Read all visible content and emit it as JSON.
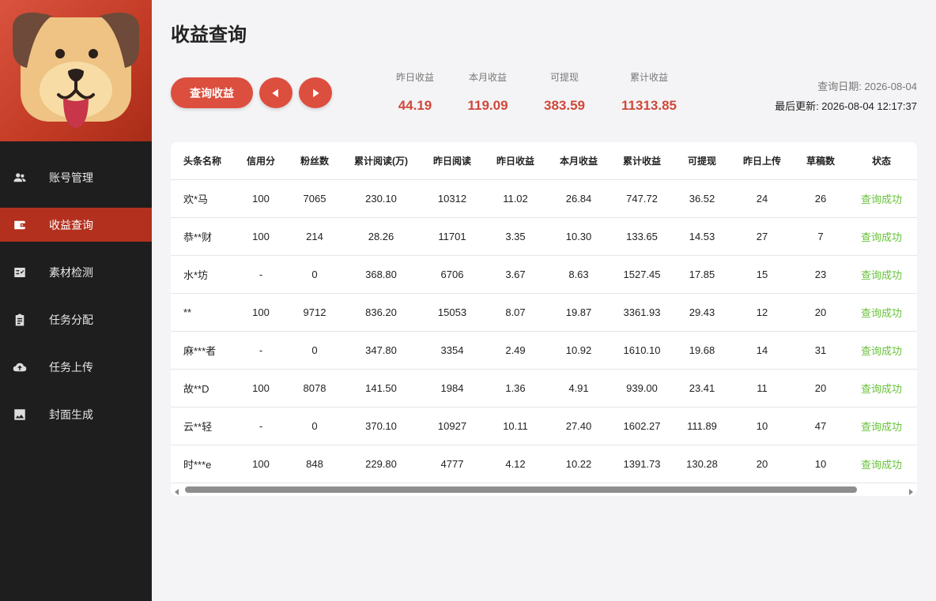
{
  "sidebar": {
    "items": [
      {
        "label": "账号管理",
        "icon": "people-icon"
      },
      {
        "label": "收益查询",
        "icon": "wallet-icon"
      },
      {
        "label": "素材检测",
        "icon": "checklist-icon"
      },
      {
        "label": "任务分配",
        "icon": "clipboard-icon"
      },
      {
        "label": "任务上传",
        "icon": "cloud-upload-icon"
      },
      {
        "label": "封面生成",
        "icon": "image-icon"
      }
    ]
  },
  "page": {
    "title": "收益查询"
  },
  "toolbar": {
    "query_label": "查询收益"
  },
  "stats": [
    {
      "label": "昨日收益",
      "value": "44.19"
    },
    {
      "label": "本月收益",
      "value": "119.09"
    },
    {
      "label": "可提现",
      "value": "383.59"
    },
    {
      "label": "累计收益",
      "value": "11313.85"
    }
  ],
  "query_info": {
    "date": "查询日期: 2026-08-04",
    "last_update": "最后更新: 2026-08-04 12:17:37"
  },
  "table": {
    "headers": [
      "头条名称",
      "信用分",
      "粉丝数",
      "累计阅读(万)",
      "昨日阅读",
      "昨日收益",
      "本月收益",
      "累计收益",
      "可提现",
      "昨日上传",
      "草稿数",
      "状态"
    ],
    "rows": [
      [
        "欢*马",
        "100",
        "7065",
        "230.10",
        "10312",
        "11.02",
        "26.84",
        "747.72",
        "36.52",
        "24",
        "26",
        "查询成功"
      ],
      [
        "恭**财",
        "100",
        "214",
        "28.26",
        "11701",
        "3.35",
        "10.30",
        "133.65",
        "14.53",
        "27",
        "7",
        "查询成功"
      ],
      [
        "水*坊",
        "-",
        "0",
        "368.80",
        "6706",
        "3.67",
        "8.63",
        "1527.45",
        "17.85",
        "15",
        "23",
        "查询成功"
      ],
      [
        "**",
        "100",
        "9712",
        "836.20",
        "15053",
        "8.07",
        "19.87",
        "3361.93",
        "29.43",
        "12",
        "20",
        "查询成功"
      ],
      [
        "麻***者",
        "-",
        "0",
        "347.80",
        "3354",
        "2.49",
        "10.92",
        "1610.10",
        "19.68",
        "14",
        "31",
        "查询成功"
      ],
      [
        "故**D",
        "100",
        "8078",
        "141.50",
        "1984",
        "1.36",
        "4.91",
        "939.00",
        "23.41",
        "11",
        "20",
        "查询成功"
      ],
      [
        "云**轻",
        "-",
        "0",
        "370.10",
        "10927",
        "10.11",
        "27.40",
        "1602.27",
        "111.89",
        "10",
        "47",
        "查询成功"
      ],
      [
        "时***e",
        "100",
        "848",
        "229.80",
        "4777",
        "4.12",
        "10.22",
        "1391.73",
        "130.28",
        "20",
        "10",
        "查询成功"
      ]
    ]
  },
  "colors": {
    "accent": "#dc4e3e",
    "sidebar": "#1e1e1e",
    "active": "#b3301e",
    "success": "#67c23a"
  }
}
